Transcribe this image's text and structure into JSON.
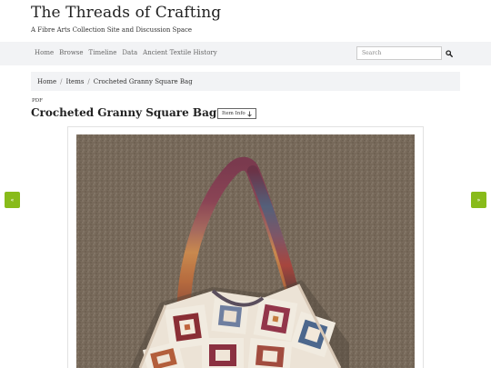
{
  "site": {
    "title": "The Threads of Crafting",
    "tagline": "A Fibre Arts Collection Site and Discussion Space"
  },
  "nav": {
    "items": [
      {
        "label": "Home"
      },
      {
        "label": "Browse"
      },
      {
        "label": "Timeline"
      },
      {
        "label": "Data"
      },
      {
        "label": "Ancient Textile History"
      }
    ]
  },
  "search": {
    "placeholder": "Search",
    "icon": "search-icon"
  },
  "breadcrumb": {
    "items": [
      "Home",
      "Items",
      "Crocheted Granny Square Bag"
    ],
    "separator": "/"
  },
  "item": {
    "file_type": "PDF",
    "title": "Crocheted Granny Square Bag",
    "info_button_label": "Item Info",
    "info_button_icon": "arrow-down-icon"
  },
  "viewer": {
    "prev_label": "«",
    "next_label": "»",
    "accent_color": "#88bb1a"
  },
  "colors": {
    "nav_bg": "#f2f3f5",
    "carpet": "#77695a"
  }
}
